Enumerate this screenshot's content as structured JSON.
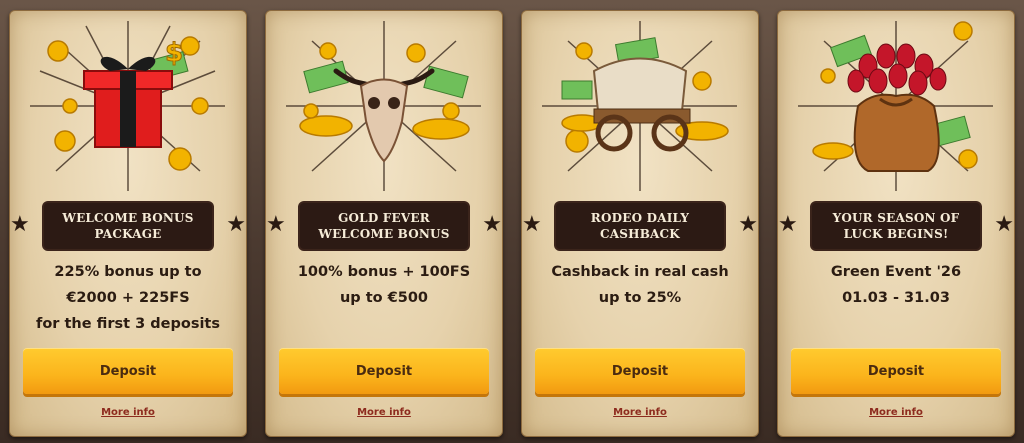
{
  "colors": {
    "card_bg": "#e6d2ac",
    "banner_bg": "#2c1a14",
    "banner_text": "#f6ecd8",
    "button_yellow": "#fbb41c",
    "link_red": "#8d2b1e"
  },
  "cards": [
    {
      "icon": "gift-box-coins-icon",
      "banner": "WELCOME BONUS\nPACKAGE",
      "lines": [
        "225% bonus up to",
        "€2000 + 225FS",
        "for the first 3 deposits"
      ],
      "button": "Deposit",
      "link": "More info"
    },
    {
      "icon": "bull-skull-coins-icon",
      "banner": "GOLD FEVER\nWELCOME BONUS",
      "lines": [
        "100% bonus + 100FS",
        "up to €500"
      ],
      "button": "Deposit",
      "link": "More info"
    },
    {
      "icon": "covered-wagon-coins-icon",
      "banner": "RODEO DAILY\nCASHBACK",
      "lines": [
        "Cashback in real cash",
        "up to 25%"
      ],
      "button": "Deposit",
      "link": "More info"
    },
    {
      "icon": "tulip-money-bag-icon",
      "banner": "YOUR SEASON OF\nLUCK BEGINS!",
      "lines": [
        "Green Event '26",
        "01.03 - 31.03"
      ],
      "button": "Deposit",
      "link": "More info"
    }
  ]
}
